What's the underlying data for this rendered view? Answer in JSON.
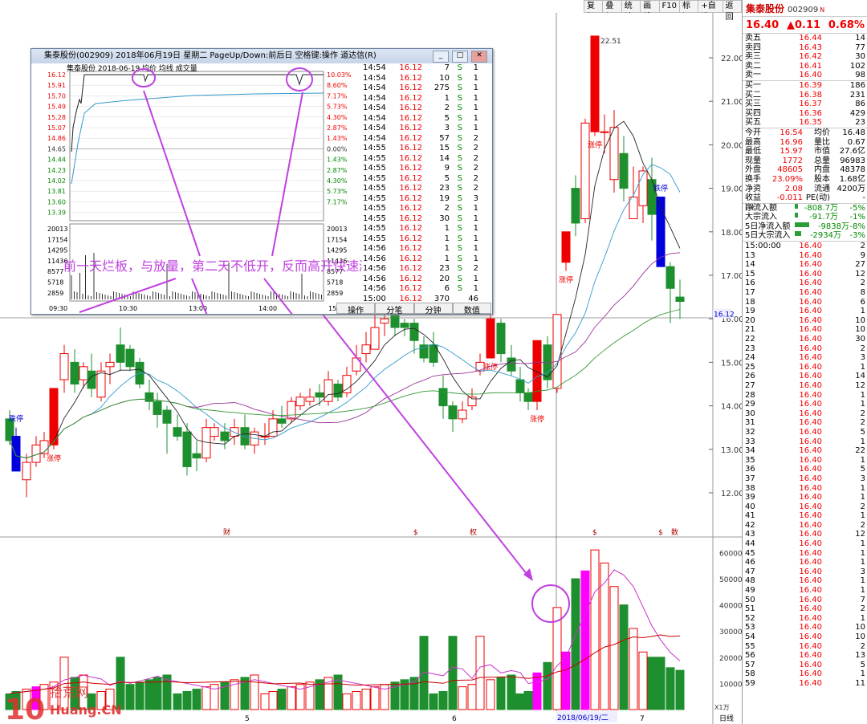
{
  "toolbar": [
    "复权",
    "叠加",
    "统计",
    "画线",
    "F10",
    "标记",
    "+自选",
    "返回"
  ],
  "main": {
    "y_ticks": [
      "22.00",
      "21.00",
      "20.00",
      "19.00",
      "18.00",
      "17.00",
      "16.00",
      "15.00",
      "14.00",
      "13.00",
      "12.00"
    ],
    "max_price_label": "22.51",
    "cross_price": "16.12",
    "vol_ticks": [
      "60000",
      "50000",
      "40000",
      "30000",
      "20000",
      "10000"
    ],
    "vol_unit": "X1万",
    "date_label": "2018/06/19/二",
    "x_labels": [
      "5",
      "6",
      "7"
    ],
    "daily_button": "日线",
    "annotation": "前一天烂板，与放量，第二天不低开，反而高开快速涨停",
    "labels": {
      "zt": "涨停",
      "dt": "跌停"
    },
    "markers": [
      "财",
      "$",
      "权",
      "$",
      "$",
      "数",
      "拾"
    ],
    "watermark_cn": "拾荒网",
    "watermark_en": "Huang.CN",
    "watermark_num": "10"
  },
  "popup": {
    "title": "集泰股份(002909) 2018年06月19日 星期二 PageUp/Down:前后日 空格键:操作 道达信(R)",
    "chart_title": "集泰股份 2018-06-19 均价 均线 成交量",
    "price_left": [
      "16.12",
      "15.91",
      "15.70",
      "15.49",
      "15.28",
      "15.07",
      "14.86",
      "14.65",
      "14.44",
      "14.23",
      "14.02",
      "13.81",
      "13.60",
      "13.39"
    ],
    "price_right": [
      "10.03%",
      "8.60%",
      "7.17%",
      "5.73%",
      "4.30%",
      "2.87%",
      "1.43%",
      "0.00%",
      "1.43%",
      "2.87%",
      "4.30%",
      "5.73%",
      "7.17%"
    ],
    "vol_left": [
      "20013",
      "17154",
      "14295",
      "11436",
      "8577",
      "5718",
      "2859"
    ],
    "x_labels": [
      "09:30",
      "10:30",
      "13:00",
      "14:00",
      "15:00"
    ],
    "ticks": [
      [
        "14:54",
        "16.12",
        "7",
        "S",
        "1"
      ],
      [
        "14:54",
        "16.12",
        "10",
        "S",
        "1"
      ],
      [
        "14:54",
        "16.12",
        "275",
        "S",
        "1"
      ],
      [
        "14:54",
        "16.12",
        "1",
        "S",
        "1"
      ],
      [
        "14:54",
        "16.12",
        "2",
        "S",
        "1"
      ],
      [
        "14:54",
        "16.12",
        "5",
        "S",
        "1"
      ],
      [
        "14:54",
        "16.12",
        "3",
        "S",
        "1"
      ],
      [
        "14:54",
        "16.12",
        "57",
        "S",
        "2"
      ],
      [
        "14:55",
        "16.12",
        "15",
        "S",
        "2"
      ],
      [
        "14:55",
        "16.12",
        "14",
        "S",
        "2"
      ],
      [
        "14:55",
        "16.12",
        "9",
        "S",
        "2"
      ],
      [
        "14:55",
        "16.12",
        "5",
        "S",
        "2"
      ],
      [
        "14:55",
        "16.12",
        "23",
        "S",
        "2"
      ],
      [
        "14:55",
        "16.12",
        "19",
        "S",
        "3"
      ],
      [
        "14:55",
        "16.12",
        "2",
        "S",
        "1"
      ],
      [
        "14:55",
        "16.12",
        "30",
        "S",
        "1"
      ],
      [
        "14:55",
        "16.12",
        "1",
        "S",
        "1"
      ],
      [
        "14:55",
        "16.12",
        "1",
        "S",
        "1"
      ],
      [
        "14:56",
        "16.12",
        "1",
        "S",
        "1"
      ],
      [
        "14:56",
        "16.12",
        "1",
        "S",
        "1"
      ],
      [
        "14:56",
        "16.12",
        "23",
        "S",
        "2"
      ],
      [
        "14:56",
        "16.12",
        "20",
        "S",
        "1"
      ],
      [
        "14:56",
        "16.12",
        "6",
        "S",
        "1"
      ],
      [
        "15:00",
        "16.12",
        "370",
        "",
        "46"
      ]
    ],
    "footer": [
      "操作",
      "分笔",
      "分钟",
      "数值"
    ]
  },
  "quote": {
    "name": "集泰股份",
    "code": "002909",
    "flag": "N",
    "price": "16.40",
    "change": "▲0.11",
    "pct": "0.68%",
    "asks": [
      [
        "卖五",
        "16.44",
        "14"
      ],
      [
        "卖四",
        "16.43",
        "77"
      ],
      [
        "卖三",
        "16.42",
        "30"
      ],
      [
        "卖二",
        "16.41",
        "102"
      ],
      [
        "卖一",
        "16.40",
        "98"
      ]
    ],
    "bids": [
      [
        "买一",
        "16.39",
        "186"
      ],
      [
        "买二",
        "16.38",
        "231"
      ],
      [
        "买三",
        "16.37",
        "86"
      ],
      [
        "买四",
        "16.36",
        "429"
      ],
      [
        "买五",
        "16.35",
        "23"
      ]
    ],
    "stats": [
      [
        "今开",
        "16.54",
        "均价",
        "16.48"
      ],
      [
        "最高",
        "16.96",
        "量比",
        "0.67"
      ],
      [
        "最低",
        "15.97",
        "市值",
        "27.6亿"
      ],
      [
        "现量",
        "1772",
        "总量",
        "96983"
      ],
      [
        "外盘",
        "48605",
        "内盘",
        "48378"
      ],
      [
        "换手",
        "23.09%",
        "股本",
        "1.68亿"
      ],
      [
        "净资",
        "2.08",
        "流通",
        "4200万"
      ],
      [
        "收益(-)",
        "-0.011",
        "PE(动)",
        "-"
      ]
    ],
    "flows": [
      [
        "净流入额",
        "-808.7万",
        "-5%"
      ],
      [
        "大宗流入",
        "-91.7万",
        "-1%"
      ],
      [
        "5日净流入额",
        "-9838万",
        "-8%"
      ],
      [
        "5日大宗流入",
        "-2934万",
        "-3%"
      ]
    ],
    "trades_first_time": "15:00:00",
    "trades": [
      [
        "16.40",
        "2"
      ],
      [
        "13",
        "16.40",
        "9"
      ],
      [
        "14",
        "16.40",
        "27"
      ],
      [
        "15",
        "16.40",
        "12"
      ],
      [
        "16",
        "16.40",
        "2"
      ],
      [
        "17",
        "16.40",
        "8"
      ],
      [
        "18",
        "16.40",
        "6"
      ],
      [
        "19",
        "16.40",
        "1"
      ],
      [
        "20",
        "16.40",
        "10"
      ],
      [
        "21",
        "16.40",
        "10"
      ],
      [
        "22",
        "16.40",
        "30"
      ],
      [
        "23",
        "16.40",
        "2"
      ],
      [
        "24",
        "16.40",
        "3"
      ],
      [
        "25",
        "16.40",
        "1"
      ],
      [
        "26",
        "16.40",
        "14"
      ],
      [
        "27",
        "16.40",
        "12"
      ],
      [
        "28",
        "16.40",
        "1"
      ],
      [
        "29",
        "16.40",
        "1"
      ],
      [
        "30",
        "16.40",
        "2"
      ],
      [
        "31",
        "16.40",
        "2"
      ],
      [
        "32",
        "16.40",
        "5"
      ],
      [
        "33",
        "16.40",
        "1"
      ],
      [
        "34",
        "16.40",
        "22"
      ],
      [
        "35",
        "16.40",
        "1"
      ],
      [
        "36",
        "16.40",
        "5"
      ],
      [
        "37",
        "16.40",
        "3"
      ],
      [
        "38",
        "16.40",
        "1"
      ],
      [
        "39",
        "16.40",
        "1"
      ],
      [
        "40",
        "16.40",
        "2"
      ],
      [
        "41",
        "16.40",
        "1"
      ],
      [
        "42",
        "16.40",
        "2"
      ],
      [
        "43",
        "16.40",
        "12"
      ],
      [
        "44",
        "16.40",
        "1"
      ],
      [
        "45",
        "16.40",
        "1"
      ],
      [
        "46",
        "16.40",
        "1"
      ],
      [
        "47",
        "16.40",
        "3"
      ],
      [
        "48",
        "16.40",
        "1"
      ],
      [
        "49",
        "16.40",
        "1"
      ],
      [
        "50",
        "16.40",
        "7"
      ],
      [
        "51",
        "16.40",
        "2"
      ],
      [
        "52",
        "16.40",
        "1"
      ],
      [
        "53",
        "16.40",
        "10"
      ],
      [
        "54",
        "16.40",
        "10"
      ],
      [
        "55",
        "16.40",
        "2"
      ],
      [
        "56",
        "16.40",
        "13"
      ],
      [
        "57",
        "16.40",
        "5"
      ],
      [
        "58",
        "16.40",
        "1"
      ],
      [
        "59",
        "16.40",
        "11"
      ]
    ]
  },
  "colors": {
    "up": "#ee0000",
    "down": "#1e8f2e",
    "limit_down": "#0000dd",
    "annotation": "#c040e0",
    "ma5": "#222222",
    "ma10": "#3399cc",
    "ma20": "#993399",
    "ma60": "#339933"
  }
}
